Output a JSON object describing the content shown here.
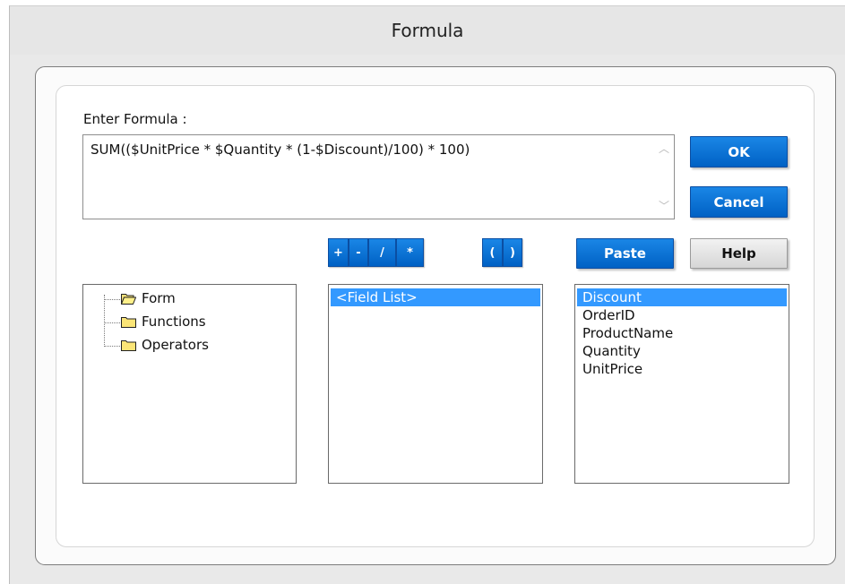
{
  "window": {
    "title": "Formula"
  },
  "formula": {
    "label": "Enter Formula :",
    "value": "SUM(($UnitPrice * $Quantity * (1-$Discount)/100) * 100)"
  },
  "buttons": {
    "ok": "OK",
    "cancel": "Cancel",
    "paste": "Paste",
    "help": "Help"
  },
  "operators": [
    "+",
    "-",
    "/",
    "*"
  ],
  "parens": [
    "(",
    ")"
  ],
  "tree": {
    "items": [
      {
        "label": "Form",
        "icon": "open-folder-icon"
      },
      {
        "label": "Functions",
        "icon": "folder-icon"
      },
      {
        "label": "Operators",
        "icon": "folder-icon"
      }
    ]
  },
  "middle_list": {
    "items": [
      "<Field List>"
    ],
    "selected_index": 0
  },
  "fields_list": {
    "items": [
      "Discount",
      "OrderID",
      "ProductName",
      "Quantity",
      "UnitPrice"
    ],
    "selected_index": 0
  },
  "colors": {
    "button_blue": "#0a74da",
    "selection": "#3399ff"
  }
}
